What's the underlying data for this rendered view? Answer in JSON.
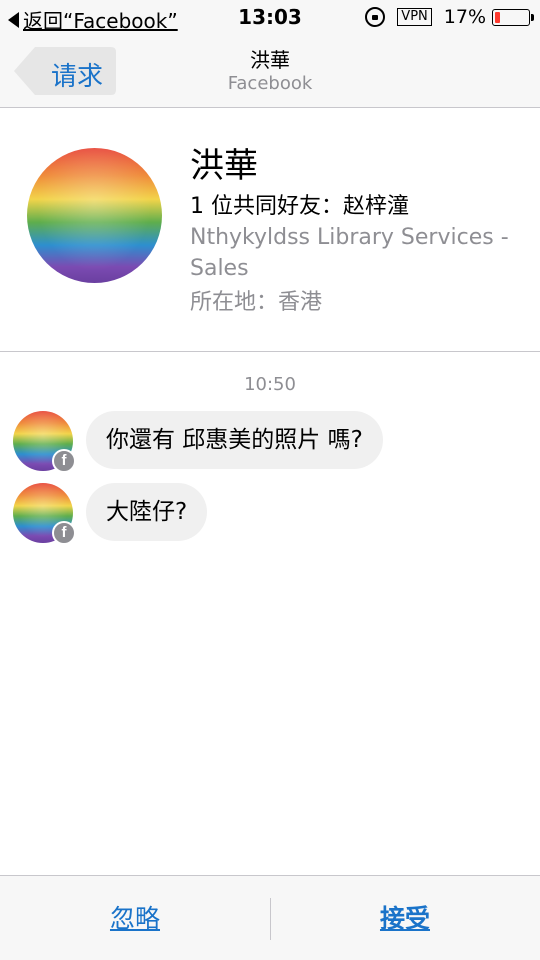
{
  "status_bar": {
    "back_label": "返回“Facebook”",
    "time": "13:03",
    "vpn": "VPN",
    "battery_percent": "17%",
    "battery_level": 0.17,
    "icons": [
      "back-triangle-icon",
      "rotation-lock-icon",
      "battery-icon"
    ]
  },
  "nav": {
    "back_label": "请求",
    "title": "洪華",
    "subtitle": "Facebook"
  },
  "profile": {
    "name": "洪華",
    "mutual_friends": "1 位共同好友：赵梓潼",
    "work": "Nthykyldss Library Services - Sales",
    "location": "所在地：香港"
  },
  "conversation": {
    "timestamp": "10:50",
    "messages": [
      {
        "text": "你還有 邱惠美的照片  嗎?"
      },
      {
        "text": "大陸仔?"
      }
    ],
    "badge_glyph": "f"
  },
  "actions": {
    "ignore_label": "忽略",
    "accept_label": "接受"
  },
  "colors": {
    "accent": "#1a73c9",
    "secondary_text": "#8e8e93",
    "bubble": "#f0f0f0",
    "battery_low": "#ff3b30"
  }
}
